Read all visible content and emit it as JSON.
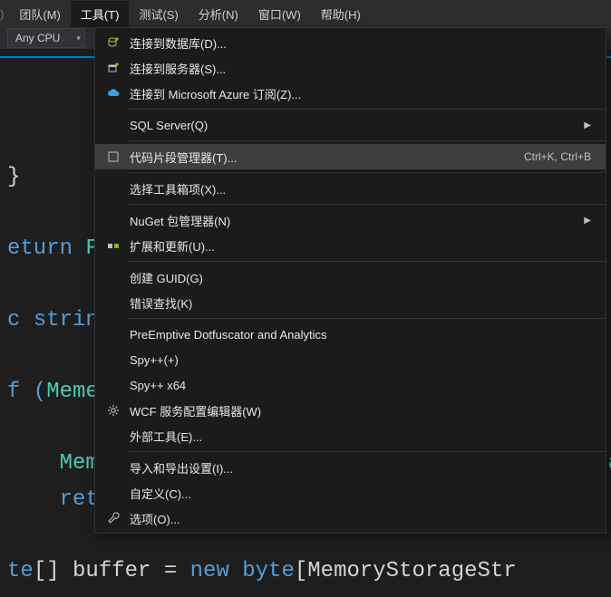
{
  "menubar": {
    "items": [
      {
        "label": "团队(M)"
      },
      {
        "label": "工具(T)",
        "active": true
      },
      {
        "label": "测试(S)"
      },
      {
        "label": "分析(N)"
      },
      {
        "label": "窗口(W)"
      },
      {
        "label": "帮助(H)"
      }
    ]
  },
  "toolbar": {
    "config": "Any CPU"
  },
  "dropdown": {
    "items": [
      {
        "icon": "db-plus",
        "label": "连接到数据库(D)..."
      },
      {
        "icon": "srv-plus",
        "label": "连接到服务器(S)..."
      },
      {
        "icon": "cloud",
        "label": "连接到 Microsoft Azure 订阅(Z)..."
      },
      {
        "sep": true
      },
      {
        "label": "SQL Server(Q)",
        "submenu": true
      },
      {
        "sep": true
      },
      {
        "icon": "snippet",
        "label": "代码片段管理器(T)...",
        "shortcut": "Ctrl+K, Ctrl+B",
        "highlight": true
      },
      {
        "sep": true
      },
      {
        "label": "选择工具箱项(X)..."
      },
      {
        "sep": true
      },
      {
        "label": "NuGet 包管理器(N)",
        "submenu": true
      },
      {
        "icon": "ext",
        "label": "扩展和更新(U)..."
      },
      {
        "sep": true
      },
      {
        "label": "创建 GUID(G)"
      },
      {
        "label": "错误查找(K)"
      },
      {
        "sep": true
      },
      {
        "label": "PreEmptive Dotfuscator and Analytics"
      },
      {
        "label": "Spy++(+)"
      },
      {
        "label": "Spy++ x64"
      },
      {
        "icon": "gear",
        "label": "WCF 服务配置编辑器(W)"
      },
      {
        "label": "外部工具(E)..."
      },
      {
        "sep": true
      },
      {
        "label": "导入和导出设置(I)..."
      },
      {
        "label": "自定义(C)..."
      },
      {
        "icon": "wrench",
        "label": "选项(O)..."
      }
    ]
  },
  "code": {
    "l1a": "eturn ",
    "l1b": "F",
    "l2a": "c ",
    "l2b": "strin",
    "l3a": "f (",
    "l3b": "Meme",
    "l4": "    Memc",
    "l4b": "Strea",
    "l5": "    retu",
    "l6a": "te",
    "l6b": "[] buffer = ",
    "l6c": "new ",
    "l6d": "byte",
    "l6e": "[MemoryStorageStr"
  }
}
